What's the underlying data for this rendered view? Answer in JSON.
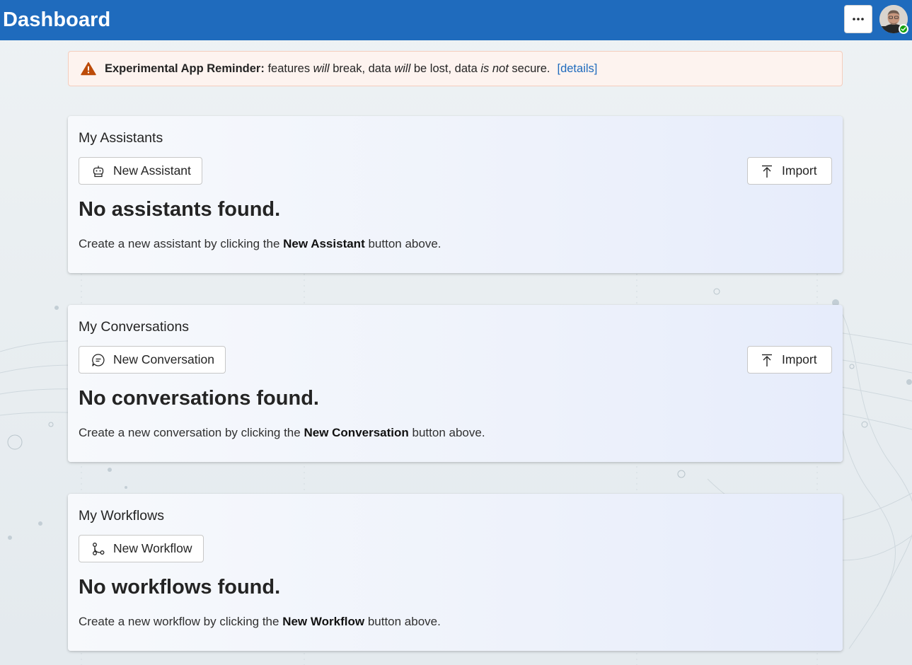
{
  "header": {
    "title": "Dashboard",
    "more_icon": "ellipsis-icon",
    "avatar_icon": "user-avatar",
    "presence_icon": "available-check-icon"
  },
  "banner": {
    "icon": "warning-icon",
    "label": "Experimental App Reminder:",
    "text_1": "features",
    "em_1": "will",
    "text_2": "break, data",
    "em_2": "will",
    "text_3": "be lost, data",
    "em_3": "is not",
    "text_4": "secure.",
    "details_link": "[details]"
  },
  "sections": {
    "assistants": {
      "title": "My Assistants",
      "new_button": "New Assistant",
      "new_icon": "bot-icon",
      "import_button": "Import",
      "import_icon": "arrow-upload-icon",
      "empty_title": "No assistants found.",
      "empty_pre": "Create a new assistant by clicking the",
      "empty_bold": "New Assistant",
      "empty_post": "button above."
    },
    "conversations": {
      "title": "My Conversations",
      "new_button": "New Conversation",
      "new_icon": "chat-icon",
      "import_button": "Import",
      "import_icon": "arrow-upload-icon",
      "empty_title": "No conversations found.",
      "empty_pre": "Create a new conversation by clicking the",
      "empty_bold": "New Conversation",
      "empty_post": "button above."
    },
    "workflows": {
      "title": "My Workflows",
      "new_button": "New Workflow",
      "new_icon": "workflow-icon",
      "empty_title": "No workflows found.",
      "empty_pre": "Create a new workflow by clicking the",
      "empty_bold": "New Workflow",
      "empty_post": "button above."
    }
  },
  "colors": {
    "header_bg": "#1f6bbd",
    "warning": "#bc4b09",
    "link": "#1f6bbd",
    "presence": "#13a10e"
  }
}
